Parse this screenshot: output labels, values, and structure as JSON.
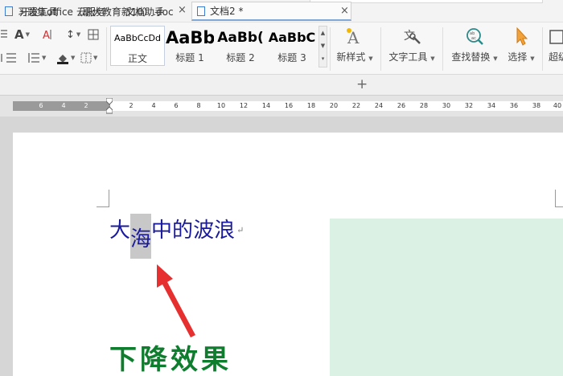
{
  "menu": {
    "tabs": [
      "开发工具",
      "云服务",
      "文档助手"
    ]
  },
  "ribbon": {
    "font_size_up": "A",
    "line_spacing_icon": "↕",
    "styles": [
      {
        "sample": "AaBbCcDd",
        "label": "正文"
      },
      {
        "sample": "AaBb",
        "label": "标题 1"
      },
      {
        "sample": "AaBb(",
        "label": "标题 2"
      },
      {
        "sample": "AaBbC",
        "label": "标题 3"
      }
    ],
    "new_style": "新样式",
    "text_tools": "文字工具",
    "find_replace": "查找替换",
    "select": "选择",
    "more": "超级"
  },
  "tabs": [
    {
      "title": "习题集office（职大教育新10）.doc"
    },
    {
      "title": "文档2 *"
    }
  ],
  "ruler": {
    "left_numbers": [
      "6",
      "4",
      "2"
    ],
    "right_numbers": [
      "2",
      "4",
      "6",
      "8",
      "10",
      "12",
      "14",
      "16",
      "18",
      "20",
      "22",
      "24",
      "26",
      "28",
      "30",
      "32",
      "34",
      "36",
      "38",
      "40"
    ]
  },
  "document": {
    "line_chars": [
      "大",
      "海",
      "中",
      "的",
      "波",
      "浪"
    ],
    "paragraph_mark": "↵",
    "caption": "下降效果"
  },
  "colors": {
    "text_blue": "#1a1a9e",
    "highlight_gray": "#c8c8c8",
    "caption_green": "#0e7d2e",
    "arrow_red": "#e63030",
    "shape_green": "#daf1e4"
  }
}
